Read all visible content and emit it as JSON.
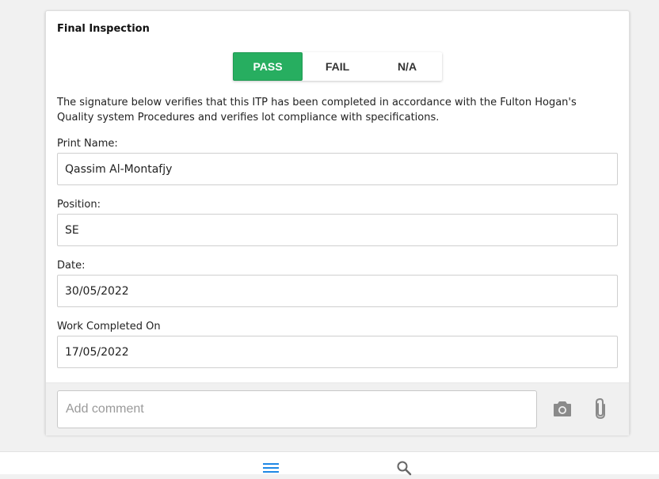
{
  "section": {
    "title": "Final Inspection"
  },
  "result_toggle": {
    "options": [
      "PASS",
      "FAIL",
      "N/A"
    ],
    "selected": "PASS",
    "selected_color": "#27ae60"
  },
  "description": "The signature below verifies that this ITP has been completed in accordance with the Fulton Hogan's Quality system Procedures and verifies lot compliance with specifications.",
  "fields": [
    {
      "label": "Print Name:",
      "value": "Qassim Al-Montafjy"
    },
    {
      "label": "Position:",
      "value": "SE"
    },
    {
      "label": "Date:",
      "value": "30/05/2022"
    },
    {
      "label": "Work Completed On",
      "value": "17/05/2022"
    }
  ],
  "comment": {
    "placeholder": "Add comment",
    "camera_icon": "camera-icon",
    "attach_icon": "paperclip-icon"
  },
  "bottom_nav": {
    "items": [
      "menu-icon",
      "search-icon"
    ],
    "accent": "#1e88e5"
  }
}
